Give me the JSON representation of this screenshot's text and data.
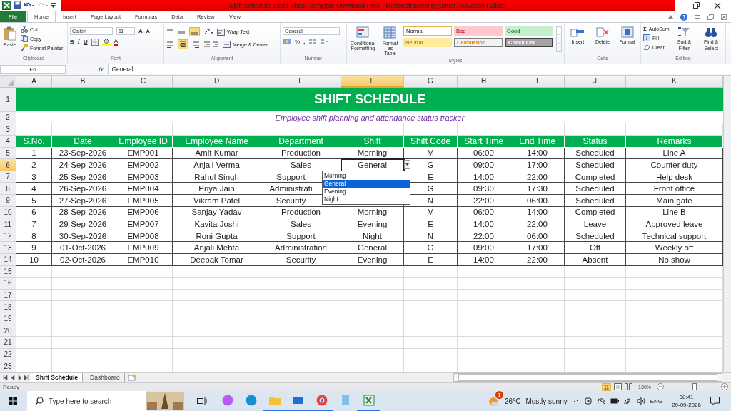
{
  "window": {
    "title": "Shift Schedule Excel Sheet Template Download Free - Microsoft Excel (Product Activation Failed)"
  },
  "ribbon": {
    "tabs": [
      {
        "label": "File",
        "kind": "file",
        "selected": false
      },
      {
        "label": "Home",
        "kind": "tab",
        "selected": true
      },
      {
        "label": "Insert",
        "kind": "tab",
        "selected": false
      },
      {
        "label": "Page Layout",
        "kind": "tab",
        "selected": false
      },
      {
        "label": "Formulas",
        "kind": "tab",
        "selected": false
      },
      {
        "label": "Data",
        "kind": "tab",
        "selected": false
      },
      {
        "label": "Review",
        "kind": "tab",
        "selected": false
      },
      {
        "label": "View",
        "kind": "tab",
        "selected": false
      }
    ],
    "clipboard": {
      "label": "Clipboard",
      "paste": "Paste",
      "cut": "Cut",
      "copy": "Copy",
      "format_painter": "Format Painter"
    },
    "font": {
      "label": "Font",
      "font_name": "Calibri",
      "font_size": "11",
      "grow": "A",
      "shrink": "A",
      "bold": "B",
      "italic": "I",
      "underline": "U",
      "font_color": "A"
    },
    "alignment": {
      "label": "Alignment",
      "wrap_text": "Wrap Text",
      "merge_center": "Merge & Center"
    },
    "number": {
      "label": "Number",
      "format": "General",
      "percent": "%",
      "comma": ","
    },
    "styles": {
      "label": "Styles",
      "conditional": "Conditional Formatting",
      "format_table": "Format as Table",
      "cell_styles": [
        {
          "label": "Normal",
          "kind": "normal"
        },
        {
          "label": "Bad",
          "kind": "bad"
        },
        {
          "label": "Good",
          "kind": "good"
        },
        {
          "label": "Neutral",
          "kind": "neutral"
        },
        {
          "label": "Calculation",
          "kind": "calculation"
        },
        {
          "label": "Check Cell",
          "kind": "check"
        }
      ]
    },
    "cells": {
      "label": "Cells",
      "insert": "Insert",
      "delete": "Delete",
      "format": "Format"
    },
    "editing": {
      "label": "Editing",
      "autosum_sign": "Σ",
      "autosum": "AutoSum",
      "fill": "Fill",
      "clear": "Clear",
      "sort": "Sort & Filter",
      "find": "Find & Select"
    }
  },
  "formula_bar": {
    "name_box": "F6",
    "fx": "fx",
    "value": "General"
  },
  "columns": [
    {
      "label": "A",
      "selected": false
    },
    {
      "label": "B",
      "selected": false
    },
    {
      "label": "C",
      "selected": false
    },
    {
      "label": "D",
      "selected": false
    },
    {
      "label": "E",
      "selected": false
    },
    {
      "label": "F",
      "selected": true
    },
    {
      "label": "G",
      "selected": false
    },
    {
      "label": "H",
      "selected": false
    },
    {
      "label": "I",
      "selected": false
    },
    {
      "label": "J",
      "selected": false
    },
    {
      "label": "K",
      "selected": false
    }
  ],
  "row_headers": [
    {
      "label": "1",
      "selected": false
    },
    {
      "label": "2",
      "selected": false
    },
    {
      "label": "3",
      "selected": false
    },
    {
      "label": "4",
      "selected": false
    },
    {
      "label": "5",
      "selected": false
    },
    {
      "label": "6",
      "selected": true
    },
    {
      "label": "7",
      "selected": false
    },
    {
      "label": "8",
      "selected": false
    },
    {
      "label": "9",
      "selected": false
    },
    {
      "label": "10",
      "selected": false
    },
    {
      "label": "11",
      "selected": false
    },
    {
      "label": "12",
      "selected": false
    },
    {
      "label": "13",
      "selected": false
    },
    {
      "label": "14",
      "selected": false
    },
    {
      "label": "15",
      "selected": false
    },
    {
      "label": "16",
      "selected": false
    },
    {
      "label": "17",
      "selected": false
    },
    {
      "label": "18",
      "selected": false
    },
    {
      "label": "19",
      "selected": false
    },
    {
      "label": "20",
      "selected": false
    },
    {
      "label": "21",
      "selected": false
    },
    {
      "label": "22",
      "selected": false
    },
    {
      "label": "23",
      "selected": false
    }
  ],
  "sheet": {
    "title": "SHIFT SCHEDULE",
    "subtitle": "Employee shift planning and attendance status tracker",
    "headers": [
      "S.No.",
      "Date",
      "Employee ID",
      "Employee Name",
      "Department",
      "Shift",
      "Shift Code",
      "Start Time",
      "End Time",
      "Status",
      "Remarks"
    ],
    "rows": [
      {
        "selected": false,
        "cells": [
          "1",
          "23-Sep-2026",
          "EMP001",
          "Amit Kumar",
          "Production",
          "Morning",
          "M",
          "06:00",
          "14:00",
          "Scheduled",
          "Line A"
        ]
      },
      {
        "selected": true,
        "cells": [
          "2",
          "24-Sep-2026",
          "EMP002",
          "Anjali Verma",
          "Sales",
          "General",
          "G",
          "09:00",
          "17:00",
          "Scheduled",
          "Counter duty"
        ]
      },
      {
        "selected": false,
        "cells": [
          "3",
          "25-Sep-2026",
          "EMP003",
          "Rahul Singh",
          "Support",
          null,
          "E",
          "14:00",
          "22:00",
          "Completed",
          "Help desk"
        ]
      },
      {
        "selected": false,
        "cells": [
          "4",
          "26-Sep-2026",
          "EMP004",
          "Priya Jain",
          "Administrati",
          null,
          "G",
          "09:30",
          "17:30",
          "Scheduled",
          "Front office"
        ]
      },
      {
        "selected": false,
        "cells": [
          "5",
          "27-Sep-2026",
          "EMP005",
          "Vikram Patel",
          "Security",
          null,
          "N",
          "22:00",
          "06:00",
          "Scheduled",
          "Main gate"
        ]
      },
      {
        "selected": false,
        "cells": [
          "6",
          "28-Sep-2026",
          "EMP006",
          "Sanjay Yadav",
          "Production",
          "Morning",
          "M",
          "06:00",
          "14:00",
          "Completed",
          "Line B"
        ]
      },
      {
        "selected": false,
        "cells": [
          "7",
          "29-Sep-2026",
          "EMP007",
          "Kavita Joshi",
          "Sales",
          "Evening",
          "E",
          "14:00",
          "22:00",
          "Leave",
          "Approved leave"
        ]
      },
      {
        "selected": false,
        "cells": [
          "8",
          "30-Sep-2026",
          "EMP008",
          "Roni Gupta",
          "Support",
          "Night",
          "N",
          "22:00",
          "06:00",
          "Scheduled",
          "Technical support"
        ]
      },
      {
        "selected": false,
        "cells": [
          "9",
          "01-Oct-2026",
          "EMP009",
          "Anjali Mehta",
          "Administration",
          "General",
          "G",
          "09:00",
          "17:00",
          "Off",
          "Weekly off"
        ]
      },
      {
        "selected": false,
        "cells": [
          "10",
          "02-Oct-2026",
          "EMP010",
          "Deepak Tomar",
          "Security",
          "Evening",
          "E",
          "14:00",
          "22:00",
          "Absent",
          "No show"
        ]
      }
    ],
    "dropdown": [
      {
        "label": "Morning",
        "selected": false
      },
      {
        "label": "General",
        "selected": true
      },
      {
        "label": "Evening",
        "selected": false
      },
      {
        "label": "Night",
        "selected": false
      }
    ]
  },
  "sheet_tabs": [
    {
      "label": "Shift Schedule",
      "selected": true
    },
    {
      "label": "Dashboard",
      "selected": false
    }
  ],
  "status_bar": {
    "status": "Ready",
    "zoom": "130%",
    "zoom_slider": {
      "level": 0.55
    }
  },
  "taskbar": {
    "search_placeholder": "Type here to search",
    "apps": [
      {
        "kind": "copilot",
        "running": false
      },
      {
        "kind": "edge",
        "running": false
      },
      {
        "kind": "folder",
        "running": true
      },
      {
        "kind": "mail",
        "running": true
      },
      {
        "kind": "chrome",
        "running": true
      },
      {
        "kind": "notepad",
        "running": false
      },
      {
        "kind": "excel",
        "running": true
      }
    ],
    "weather_badge": "1",
    "temperature": "26°C",
    "weather": "Mostly sunny",
    "language": "ENG",
    "time": "08:41",
    "date": "20-09-2026"
  }
}
